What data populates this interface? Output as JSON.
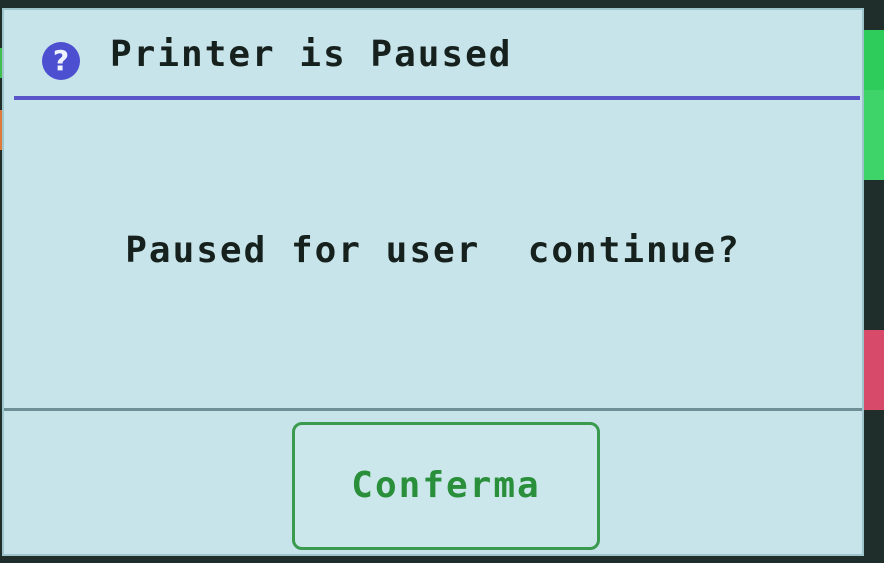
{
  "dialog": {
    "icon": "help-icon",
    "icon_glyph": "?",
    "title": "Printer is Paused",
    "message": "Paused for user  continue?",
    "confirm_label": "Conferma"
  },
  "colors": {
    "background": "#c6e4ea",
    "title_divider": "#5a55c8",
    "icon": "#4b4fd0",
    "confirm_text": "#2a8f3a",
    "confirm_border": "#3a9a4e"
  }
}
